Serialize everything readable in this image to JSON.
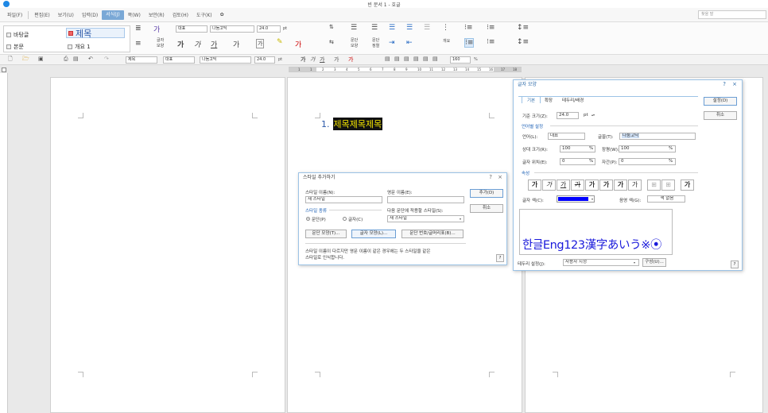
{
  "window": {
    "title": "빈 문서 1 - 호글"
  },
  "menu": {
    "items": [
      "파일(F)",
      "편집(E)",
      "보기(U)",
      "입력(D)",
      "서식(J)",
      "쪽(W)",
      "보안(R)",
      "검토(H)",
      "도구(K)"
    ],
    "active_index": 4,
    "search_placeholder": "찾을 말"
  },
  "ribbon": {
    "styles": {
      "items": [
        "바탕글",
        "본문",
        "제목",
        "개요 1"
      ]
    },
    "font_label_upper": "글자",
    "font_label_lower": "모양",
    "para_label_upper": "문단",
    "para_label_lower": "모양",
    "para_num_upper": "문단",
    "para_num_lower": "정렬",
    "outline_label": "개요",
    "lang_combo": "대표",
    "font_combo": "나눔고딕",
    "size_combo": "24.0",
    "size_unit": "pt"
  },
  "toolbar2": {
    "style_combo": "제목",
    "lang_combo": "대표",
    "font_combo": "나눔고딕",
    "size_combo": "24.0",
    "size_unit": "pt",
    "zoom": "160",
    "zoom_unit": "%"
  },
  "ruler": {
    "ticks": [
      "1",
      "1",
      "2",
      "3",
      "4",
      "5",
      "6",
      "7",
      "8",
      "9",
      "10",
      "11",
      "12",
      "13",
      "14",
      "15",
      "16",
      "17",
      "18"
    ]
  },
  "document": {
    "heading_number": "1.",
    "heading_text": "제목제목제목"
  },
  "style_dialog": {
    "title": "스타일 추가하기",
    "style_name_label": "스타일 이름(N):",
    "style_name_value": "새 스타일",
    "english_name_label": "영문 이름(E):",
    "english_name_value": "",
    "type_section": "스타일 종류",
    "type_paragraph": "문단(P)",
    "type_char": "글자(C)",
    "next_style_label": "다음 문단에 적용할 스타일(S):",
    "next_style_value": "새 스타일",
    "add_button": "추가(D)",
    "cancel_button": "취소",
    "para_shape_button": "문단 모양(T)...",
    "char_shape_button": "글자 모양(L)...",
    "numbering_button": "문단 번호/글머리표(B)...",
    "note_line1": "스타일 이름이 다르지만 영문 이름이 같은 경우에는 두 스타일을 같은",
    "note_line2": "스타일로 인식합니다.",
    "help": "?",
    "close": "×"
  },
  "char_dialog": {
    "title": "글자 모양",
    "tabs": [
      "기본",
      "확장",
      "테두리/배경"
    ],
    "set_button": "설정(D)",
    "cancel_button": "취소",
    "base_size_label": "기준 크기(Z):",
    "base_size_value": "24.0",
    "base_size_unit": "pt",
    "lang_section": "언어별 설정",
    "language_label": "언어(L):",
    "language_value": "대표",
    "font_label": "글꼴(T):",
    "font_value": "나눔고딕",
    "rel_size_label": "상대 크기(R):",
    "rel_size_value": "100",
    "width_label": "장평(W):",
    "width_value": "100",
    "position_label": "글자 위치(E):",
    "position_value": "0",
    "spacing_label": "자간(P):",
    "spacing_value": "0",
    "percent": "%",
    "attr_section": "속성",
    "attr_buttons": [
      "가",
      "가",
      "가",
      "가",
      "가",
      "가",
      "가",
      "가",
      "가",
      "가",
      "가"
    ],
    "text_color_label": "글자 색(C):",
    "text_color_value": "#0000ff",
    "shade_color_label": "음영 색(G):",
    "shade_color_value": "색 없음",
    "preview_text": "한글Eng123漢字あいう※⦿",
    "border_label": "테두리 설정(J):",
    "border_value": "사용자 지정",
    "compose_button": "구성(U)...",
    "help": "?",
    "close": "×"
  },
  "colors": {
    "accent": "#2b6aa8",
    "heading_text": "#f5e600",
    "preview_text": "#1a1adb"
  }
}
